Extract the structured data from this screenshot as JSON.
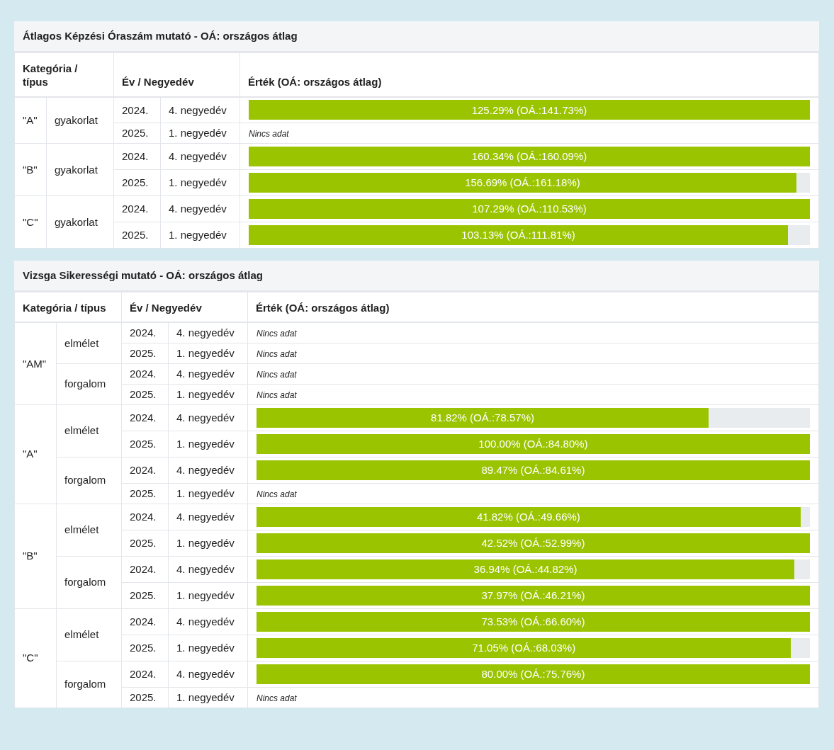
{
  "panels": [
    {
      "title": "Átlagos Képzési Óraszám mutató - OÁ: országos átlag",
      "columns": [
        "Kategória / típus",
        "Év / Negyedév",
        "Érték (OÁ: országos átlag)"
      ],
      "groups": [
        {
          "category": "\"A\"",
          "types": [
            {
              "type": "gyakorlat",
              "rows": [
                {
                  "year": "2024.",
                  "quarter": "4. negyedév",
                  "kind": "bar",
                  "value": "125.29% (OÁ.:141.73%)",
                  "level": 1
                },
                {
                  "year": "2025.",
                  "quarter": "1. negyedév",
                  "kind": "none",
                  "value": "Nincs adat"
                }
              ]
            }
          ]
        },
        {
          "category": "\"B\"",
          "types": [
            {
              "type": "gyakorlat",
              "rows": [
                {
                  "year": "2024.",
                  "quarter": "4. negyedév",
                  "kind": "bar",
                  "value": "160.34% (OÁ.:160.09%)",
                  "level": 1
                },
                {
                  "year": "2025.",
                  "quarter": "1. negyedév",
                  "kind": "bar",
                  "value": "156.69% (OÁ.:161.18%)",
                  "level": 0.976
                }
              ]
            }
          ]
        },
        {
          "category": "\"C\"",
          "types": [
            {
              "type": "gyakorlat",
              "rows": [
                {
                  "year": "2024.",
                  "quarter": "4. negyedév",
                  "kind": "bar",
                  "value": "107.29% (OÁ.:110.53%)",
                  "level": 1
                },
                {
                  "year": "2025.",
                  "quarter": "1. negyedév",
                  "kind": "bar",
                  "value": "103.13% (OÁ.:111.81%)",
                  "level": 0.961
                }
              ]
            }
          ]
        }
      ]
    },
    {
      "title": "Vizsga Sikerességi mutató - OÁ: országos átlag",
      "columns": [
        "Kategória / típus",
        "Év / Negyedév",
        "Érték (OÁ: országos átlag)"
      ],
      "groups": [
        {
          "category": "\"AM\"",
          "types": [
            {
              "type": "elmélet",
              "rows": [
                {
                  "year": "2024.",
                  "quarter": "4. negyedév",
                  "kind": "none",
                  "value": "Nincs adat"
                },
                {
                  "year": "2025.",
                  "quarter": "1. negyedév",
                  "kind": "none",
                  "value": "Nincs adat"
                }
              ]
            },
            {
              "type": "forgalom",
              "rows": [
                {
                  "year": "2024.",
                  "quarter": "4. negyedév",
                  "kind": "none",
                  "value": "Nincs adat"
                },
                {
                  "year": "2025.",
                  "quarter": "1. negyedév",
                  "kind": "none",
                  "value": "Nincs adat"
                }
              ]
            }
          ]
        },
        {
          "category": "\"A\"",
          "types": [
            {
              "type": "elmélet",
              "rows": [
                {
                  "year": "2024.",
                  "quarter": "4. negyedév",
                  "kind": "bar",
                  "value": "81.82% (OÁ.:78.57%)",
                  "level": 0.817
                },
                {
                  "year": "2025.",
                  "quarter": "1. negyedév",
                  "kind": "bar",
                  "value": "100.00% (OÁ.:84.80%)",
                  "level": 1
                }
              ]
            },
            {
              "type": "forgalom",
              "rows": [
                {
                  "year": "2024.",
                  "quarter": "4. negyedév",
                  "kind": "bar",
                  "value": "89.47% (OÁ.:84.61%)",
                  "level": 1
                },
                {
                  "year": "2025.",
                  "quarter": "1. negyedév",
                  "kind": "none",
                  "value": "Nincs adat"
                }
              ]
            }
          ]
        },
        {
          "category": "\"B\"",
          "types": [
            {
              "type": "elmélet",
              "rows": [
                {
                  "year": "2024.",
                  "quarter": "4. negyedév",
                  "kind": "bar",
                  "value": "41.82% (OÁ.:49.66%)",
                  "level": 0.983
                },
                {
                  "year": "2025.",
                  "quarter": "1. negyedév",
                  "kind": "bar",
                  "value": "42.52% (OÁ.:52.99%)",
                  "level": 1
                }
              ]
            },
            {
              "type": "forgalom",
              "rows": [
                {
                  "year": "2024.",
                  "quarter": "4. negyedév",
                  "kind": "bar",
                  "value": "36.94% (OÁ.:44.82%)",
                  "level": 0.972
                },
                {
                  "year": "2025.",
                  "quarter": "1. negyedév",
                  "kind": "bar",
                  "value": "37.97% (OÁ.:46.21%)",
                  "level": 1
                }
              ]
            }
          ]
        },
        {
          "category": "\"C\"",
          "types": [
            {
              "type": "elmélet",
              "rows": [
                {
                  "year": "2024.",
                  "quarter": "4. negyedév",
                  "kind": "bar",
                  "value": "73.53% (OÁ.:66.60%)",
                  "level": 1
                },
                {
                  "year": "2025.",
                  "quarter": "1. negyedév",
                  "kind": "bar",
                  "value": "71.05% (OÁ.:68.03%)",
                  "level": 0.966
                }
              ]
            },
            {
              "type": "forgalom",
              "rows": [
                {
                  "year": "2024.",
                  "quarter": "4. negyedév",
                  "kind": "bar",
                  "value": "80.00% (OÁ.:75.76%)",
                  "level": 1
                },
                {
                  "year": "2025.",
                  "quarter": "1. negyedév",
                  "kind": "none",
                  "value": "Nincs adat"
                }
              ]
            }
          ]
        }
      ]
    }
  ]
}
